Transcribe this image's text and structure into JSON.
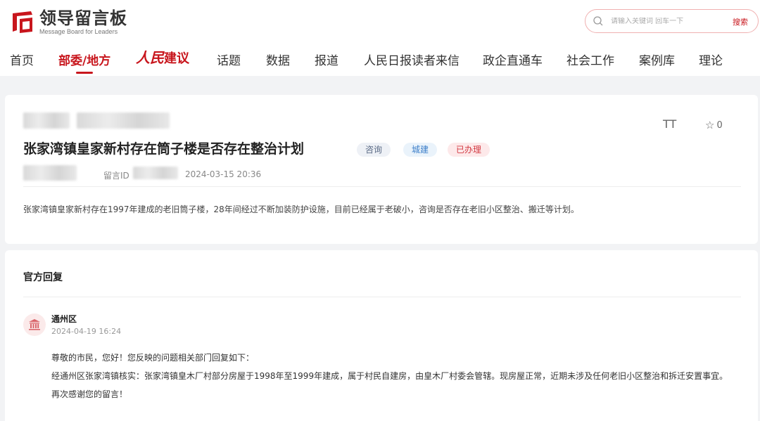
{
  "header": {
    "logo_title": "领导留言板",
    "logo_subtitle": "Message Board for Leaders",
    "search_placeholder": "请输入关键词 回车一下",
    "search_button": "搜索"
  },
  "nav": {
    "items": [
      {
        "label": "首页"
      },
      {
        "label": "部委/地方"
      },
      {
        "label_italic": "人民",
        "label_bold": "建议"
      },
      {
        "label": "话题"
      },
      {
        "label": "数据"
      },
      {
        "label": "报道"
      },
      {
        "label": "人民日报读者来信"
      },
      {
        "label": "政企直通车"
      },
      {
        "label": "社会工作"
      },
      {
        "label": "案例库"
      },
      {
        "label": "理论"
      }
    ],
    "active_index": 1
  },
  "message": {
    "font_toggle": "TT",
    "favorite_count": "0",
    "title": "张家湾镇皇家新村存在筒子楼是否存在整治计划",
    "tags": [
      "咨询",
      "城建",
      "已办理"
    ],
    "id_label": "留言ID",
    "date": "2024-03-15 20:36",
    "content": "张家湾镇皇家新村存在1997年建成的老旧筒子楼，28年间经过不断加装防护设施，目前已经属于老破小，咨询是否存在老旧小区整治、搬迁等计划。"
  },
  "reply": {
    "section_title": "官方回复",
    "department": "通州区",
    "date": "2024-04-19 16:24",
    "lines": [
      "尊敬的市民，您好！您反映的问题相关部门回复如下：",
      "经通州区张家湾镇核实：张家湾镇皇木厂村部分房屋于1998年至1999年建成，属于村民自建房，由皇木厂村委会管辖。现房屋正常，近期未涉及任何老旧小区整治和拆迁安置事宜。",
      "再次感谢您的留言！"
    ]
  },
  "colors": {
    "brand_red": "#c8161d",
    "background": "#f2f3f5"
  }
}
